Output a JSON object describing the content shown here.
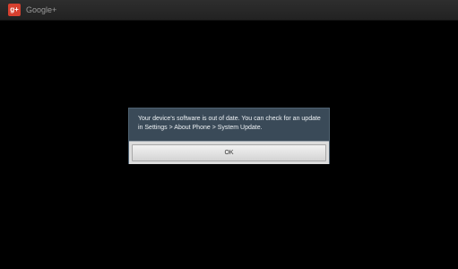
{
  "app": {
    "title": "Google+",
    "icon": "google-plus-icon",
    "icon_glyph": "g+",
    "icon_color": "#d6402f"
  },
  "dialog": {
    "message": "Your device's software is out of date. You can check for an update in Settings > About Phone > System Update.",
    "ok_label": "OK",
    "background_color": "#3a4a58"
  }
}
